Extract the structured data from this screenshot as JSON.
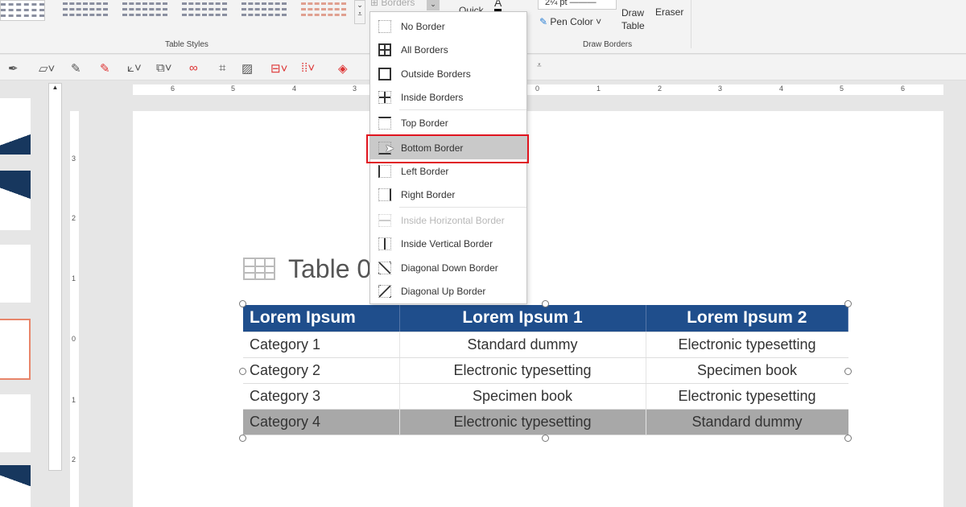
{
  "ribbon": {
    "table_styles_label": "Table Styles",
    "borders_button": "Borders",
    "quick_label": "Quick",
    "pen_weight": "2¼ pt",
    "pen_color": "Pen Color",
    "draw_table": "Draw Table",
    "eraser": "Eraser",
    "draw_borders_label": "Draw Borders"
  },
  "hruler": [
    "6",
    "5",
    "4",
    "3",
    "0",
    "1",
    "2",
    "3",
    "4",
    "5",
    "6"
  ],
  "vruler": [
    "3",
    "2",
    "1",
    "0",
    "1",
    "2"
  ],
  "slide": {
    "title": "Table 0"
  },
  "table": {
    "header": [
      "Lorem Ipsum",
      "Lorem Ipsum 1",
      "Lorem Ipsum 2"
    ],
    "rows": [
      [
        "Category 1",
        "Standard dummy",
        "Electronic typesetting"
      ],
      [
        "Category 2",
        "Electronic typesetting",
        "Specimen book"
      ],
      [
        "Category 3",
        "Specimen book",
        "Electronic typesetting"
      ],
      [
        "Category 4",
        "Electronic typesetting",
        "Standard dummy"
      ]
    ]
  },
  "menu": {
    "items": [
      "No Border",
      "All Borders",
      "Outside Borders",
      "Inside Borders",
      "Top Border",
      "Bottom Border",
      "Left Border",
      "Right Border",
      "Inside Horizontal Border",
      "Inside Vertical Border",
      "Diagonal Down Border",
      "Diagonal Up Border"
    ],
    "highlighted": "Bottom Border",
    "disabled": "Inside Horizontal Border"
  },
  "colors": {
    "header": "#1f4e8c",
    "highlight_box": "#e0141e"
  }
}
